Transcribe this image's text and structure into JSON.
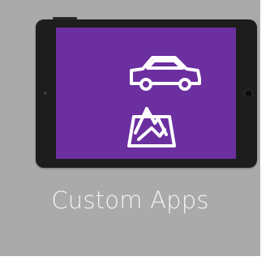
{
  "tile": {
    "label": "Custom Apps",
    "background_color": "#aaaaaa",
    "screen_color": "#6b2fa0",
    "device_color": "#1d1d1d"
  },
  "icons": {
    "car": "car-icon",
    "map": "map-icon"
  }
}
